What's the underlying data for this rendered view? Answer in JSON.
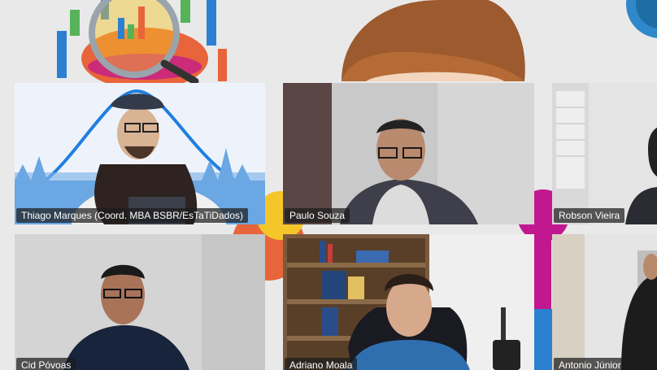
{
  "participants": [
    {
      "name": "Thiago Marques (Coord. MBA BSBR/EsTaTiDados)"
    },
    {
      "name": "Paulo Souza"
    },
    {
      "name": "Robson Vieira"
    },
    {
      "name": "Cid Póvoas"
    },
    {
      "name": "Adriano Moala"
    },
    {
      "name": "Antonio Júnior"
    }
  ],
  "colors": {
    "page_background": "#e9e9ea",
    "name_tag_background": "rgba(28,28,28,0.72)",
    "name_tag_text": "#ffffff",
    "decoration_blue": "#2d7fd1",
    "decoration_magenta": "#c2188f",
    "decoration_orange": "#e8643a",
    "decoration_yellow": "#f5c62a"
  },
  "icons": {
    "top_left": "magnifier-chart-icon",
    "top_center": "hat-mascot-icon",
    "top_right": "blue-circle-icon"
  }
}
